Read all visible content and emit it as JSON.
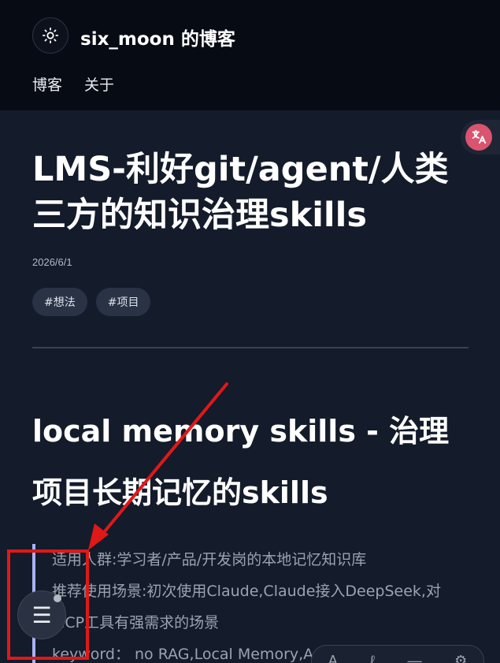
{
  "header": {
    "site_title": "six_moon 的博客",
    "theme_icon": "sun-icon",
    "nav": [
      {
        "label": "博客"
      },
      {
        "label": "关于"
      }
    ]
  },
  "translate_button": {
    "icon": "translate-icon"
  },
  "post": {
    "title": "LMS-利好git/agent/人类三方的知识治理skills",
    "date": "2026/6/1",
    "tags": [
      "#想法",
      "#项目"
    ],
    "section_title": "local memory skills - 治理项目长期记忆的skills",
    "quote_lines": [
      "适用人群:学习者/产品/开发岗的本地记忆知识库",
      "推荐使用场景:初次使用Claude,Claude接入DeepSeek,对MCP工具有强需求的场景",
      "keyword： no RAG,Local Memory,Au"
    ]
  },
  "menu_fab": {
    "label": "☰",
    "icon": "menu-icon"
  },
  "bottom_toolbar": {
    "items": [
      "A",
      "ℓ",
      "—",
      "⚙"
    ]
  },
  "annotation": {
    "color": "#e01818"
  },
  "colors": {
    "background": "#141b2a",
    "header": "#070b14",
    "accent_quote": "#a6b3f5",
    "translate": "#d9546f"
  }
}
